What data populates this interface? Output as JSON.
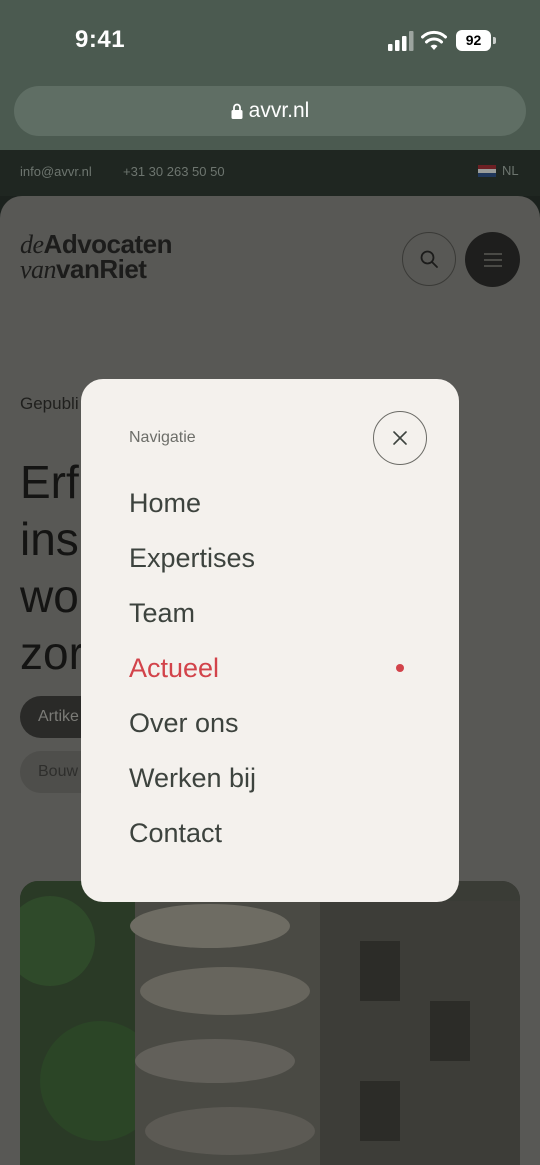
{
  "status_bar": {
    "time": "9:41",
    "battery": "92",
    "icons": [
      "signal-icon",
      "wifi-icon",
      "battery-icon"
    ]
  },
  "browser": {
    "url": "avvr.nl",
    "icon": "lock-icon"
  },
  "info_strip": {
    "email": "info@avvr.nl",
    "phone": "+31 30 263 50 50",
    "language": "NL"
  },
  "page": {
    "logo_line1_italic": "de",
    "logo_line1_bold": "Advocaten",
    "logo_line2_italic": "van",
    "logo_line2_bold": "vanRiet",
    "published": "Gepubli",
    "headline_lines": [
      "Erf",
      "ins",
      "wo",
      "zor"
    ],
    "tags": [
      "Artike",
      "Bouw"
    ]
  },
  "modal": {
    "title": "Navigatie",
    "items": [
      {
        "label": "Home",
        "active": false
      },
      {
        "label": "Expertises",
        "active": false
      },
      {
        "label": "Team",
        "active": false
      },
      {
        "label": "Actueel",
        "active": true
      },
      {
        "label": "Over ons",
        "active": false
      },
      {
        "label": "Werken bij",
        "active": false
      },
      {
        "label": "Contact",
        "active": false
      }
    ]
  },
  "colors": {
    "accent_red": "#d2434a",
    "modal_bg": "#f4f1ed",
    "browser_chrome": "#4b5a50"
  }
}
